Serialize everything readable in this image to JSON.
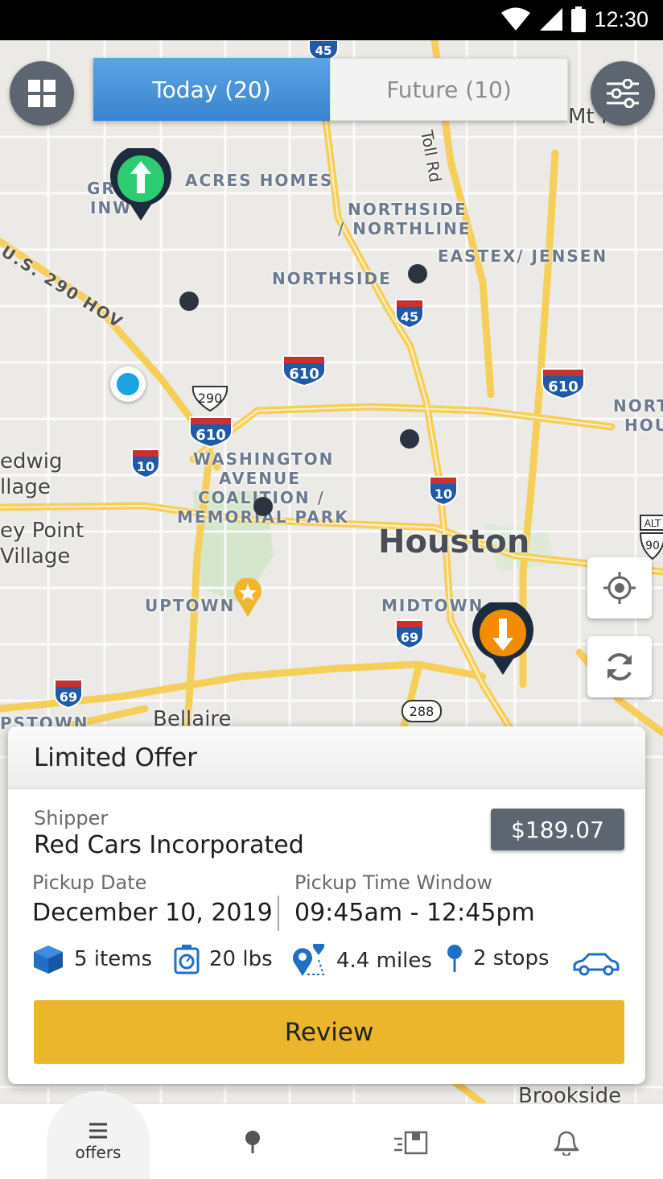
{
  "status_bar": {
    "time": "12:30"
  },
  "tabs": {
    "today": "Today (20)",
    "future": "Future (10)"
  },
  "map": {
    "labels": {
      "acres_homes": "ACRES HOMES",
      "greater_inwood_1": "GR",
      "greater_inwood_2": "INW",
      "northside_northline_1": "NORTHSIDE",
      "northside_northline_2": "/ NORTHLINE",
      "eastex_jensen": "EASTEX/ JENSEN",
      "northside": "NORTHSIDE",
      "us290_hov": "U.S. 290 HOV",
      "washington_1": "WASHINGTON",
      "washington_2": "AVENUE",
      "washington_3": "COALITION /",
      "washington_4": "MEMORIAL PARK",
      "houston": "Houston",
      "uptown": "UPTOWN",
      "midtown": "MIDTOWN",
      "spring_branch_1": "edwig",
      "spring_branch_2": "llage",
      "hunters_1": "ey Point",
      "hunters_2": "Village",
      "north_hou_1": "NORT",
      "north_hou_2": "HOU",
      "bellaire": "Bellaire",
      "westown": "PSTOWN",
      "brookside": "Brookside",
      "toll_rd": "Toll Rd",
      "mt_houston": "Mt H"
    },
    "shields": {
      "i45_top": "45",
      "i45_mid": "45",
      "i610_n": "610",
      "i610_ne": "610",
      "i610_w": "610",
      "us290": "290",
      "i10_w": "10",
      "i10_e": "10",
      "i69_mid": "69",
      "i69_sw": "69",
      "sh288": "288",
      "alt90_1": "ALT",
      "alt90_2": "90"
    }
  },
  "offer": {
    "header": "Limited Offer",
    "shipper_label": "Shipper",
    "shipper_name": "Red Cars Incorporated",
    "price": "$189.07",
    "pickup_date_label": "Pickup Date",
    "pickup_date": "December  10, 2019",
    "pickup_window_label": "Pickup Time Window",
    "pickup_window": "09:45am - 12:45pm",
    "items": "5 items",
    "weight": "20 lbs",
    "distance": "4.4 miles",
    "stops": "2 stops",
    "review_button": "Review"
  },
  "bottom_nav": {
    "offers": "offers"
  },
  "colors": {
    "accent_blue": "#3a84d0",
    "review_yellow": "#ebb52c",
    "pickup_green": "#2ecc71",
    "dropoff_orange": "#f28c00",
    "marker_navy": "#1c2b3d",
    "icon_blue": "#1f6fc5"
  }
}
